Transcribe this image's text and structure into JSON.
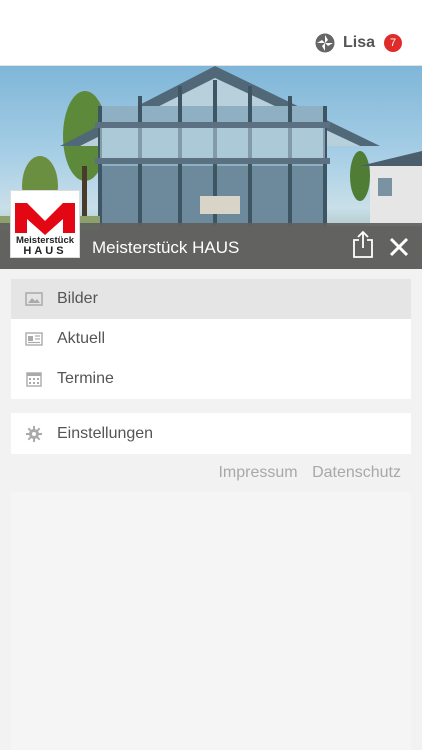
{
  "header": {
    "user_name": "Lisa",
    "notification_count": "7",
    "badge_color": "#e02b2b"
  },
  "profile": {
    "title": "Meisterstück HAUS",
    "logo_text_top": "Meisterstück",
    "logo_text_bottom": "HAUS",
    "brand_color": "#e30613"
  },
  "menu_primary": [
    {
      "label": "Bilder",
      "icon": "image-icon",
      "active": true
    },
    {
      "label": "Aktuell",
      "icon": "newspaper-icon",
      "active": false
    },
    {
      "label": "Termine",
      "icon": "calendar-icon",
      "active": false
    }
  ],
  "menu_secondary": [
    {
      "label": "Einstellungen",
      "icon": "gear-icon",
      "active": false
    }
  ],
  "footer_links": {
    "impressum": "Impressum",
    "datenschutz": "Datenschutz"
  }
}
